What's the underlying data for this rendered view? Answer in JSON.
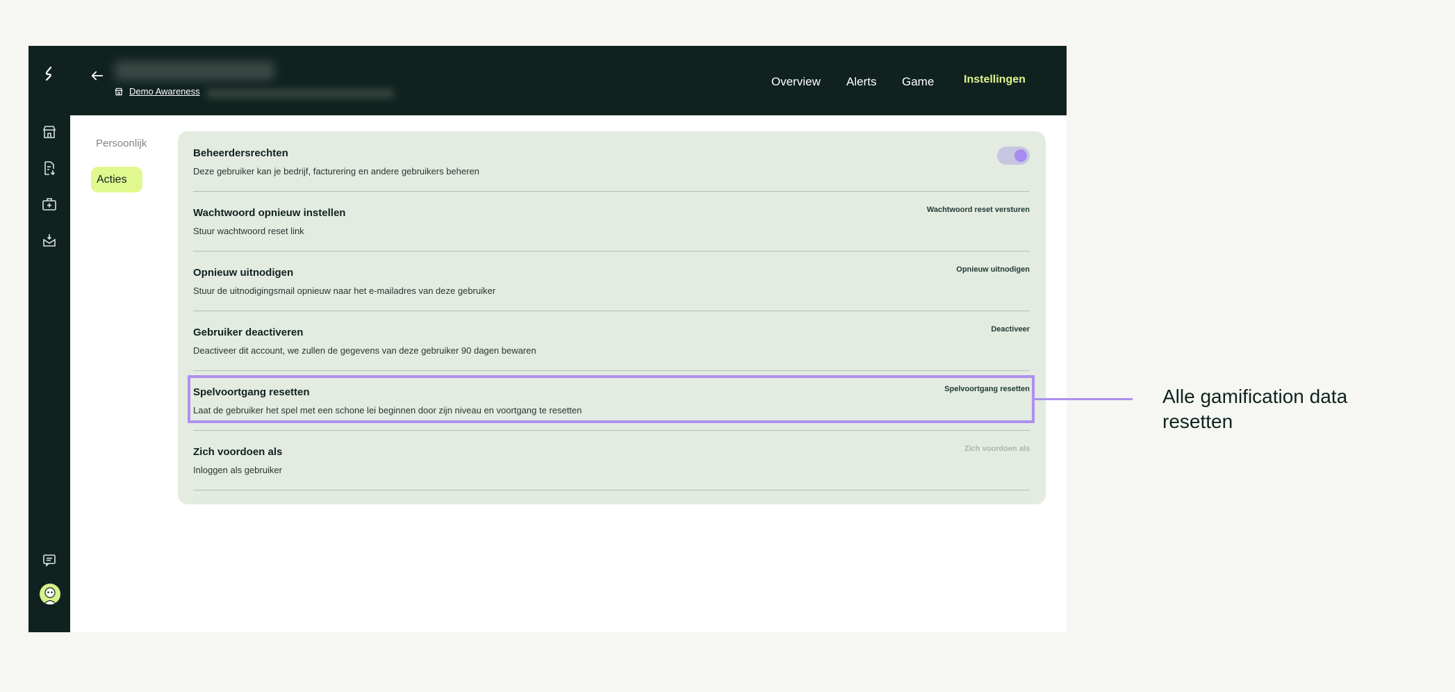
{
  "header": {
    "org_link": "Demo Awareness",
    "nav": [
      "Overview",
      "Alerts",
      "Game",
      "Instellingen"
    ],
    "active_nav": "Instellingen"
  },
  "subnav": {
    "items": [
      "Persoonlijk",
      "Acties"
    ],
    "active": "Acties"
  },
  "settings": {
    "rows": [
      {
        "title": "Beheerdersrechten",
        "description": "Deze gebruiker kan je bedrijf, facturering en andere gebruikers beheren",
        "control": "toggle",
        "toggle_on": true
      },
      {
        "title": "Wachtwoord opnieuw instellen",
        "description": "Stuur wachtwoord reset link",
        "action": "Wachtwoord reset versturen"
      },
      {
        "title": "Opnieuw uitnodigen",
        "description": "Stuur de uitnodigingsmail opnieuw naar het e-mailadres van deze gebruiker",
        "action": "Opnieuw uitnodigen"
      },
      {
        "title": "Gebruiker deactiveren",
        "description": "Deactiveer dit account, we zullen de gegevens van deze gebruiker 90 dagen bewaren",
        "action": "Deactiveer"
      },
      {
        "title": "Spelvoortgang resetten",
        "description": "Laat de gebruiker het spel met een schone lei beginnen door zijn niveau en voortgang te resetten",
        "action": "Spelvoortgang resetten"
      },
      {
        "title": "Zich voordoen als",
        "description": "Inloggen als gebruiker",
        "action": "Zich voordoen als",
        "action_disabled": true
      }
    ]
  },
  "annotation": {
    "text": "Alle gamification data resetten",
    "color": "#ad90ef"
  },
  "icons": [
    "logo-icon",
    "store-icon",
    "document-download-icon",
    "medkit-icon",
    "mail-inbox-icon",
    "chat-icon",
    "avatar",
    "back-arrow-icon",
    "store-small-icon"
  ],
  "colors": {
    "dark": "#10221f",
    "accent_lime": "#dcf58f",
    "card_bg": "#e4ebe1",
    "purple": "#ad90ef"
  }
}
